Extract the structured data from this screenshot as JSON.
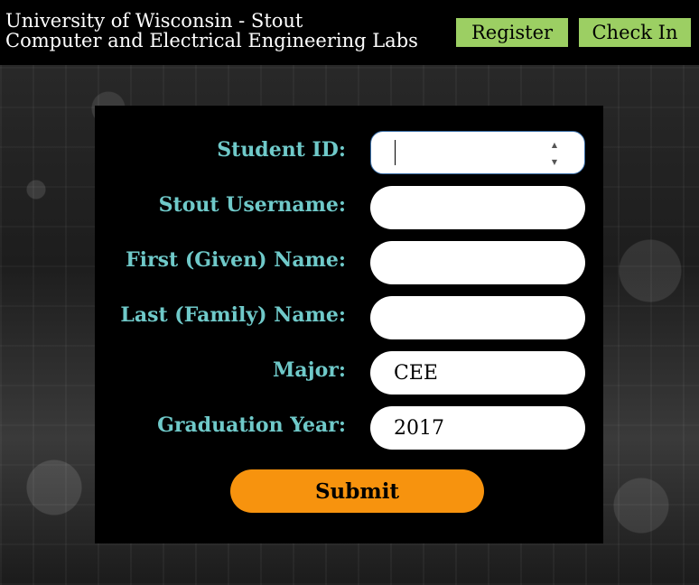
{
  "header": {
    "title_line1": "University of Wisconsin - Stout",
    "title_line2": "Computer and Electrical Engineering Labs",
    "register_label": "Register",
    "checkin_label": "Check In"
  },
  "form": {
    "fields": [
      {
        "label": "Student ID:",
        "value": ""
      },
      {
        "label": "Stout Username:",
        "value": ""
      },
      {
        "label": "First (Given) Name:",
        "value": ""
      },
      {
        "label": "Last (Family) Name:",
        "value": ""
      },
      {
        "label": "Major:",
        "value": "CEE"
      },
      {
        "label": "Graduation Year:",
        "value": "2017"
      }
    ],
    "submit_label": "Submit"
  },
  "colors": {
    "nav_button": "#9ccf63",
    "label_text": "#6fc9c9",
    "submit_button": "#f7930e",
    "panel": "#000000"
  },
  "icons": {
    "spinner_up": "chevron-up-icon",
    "spinner_down": "chevron-down-icon"
  }
}
